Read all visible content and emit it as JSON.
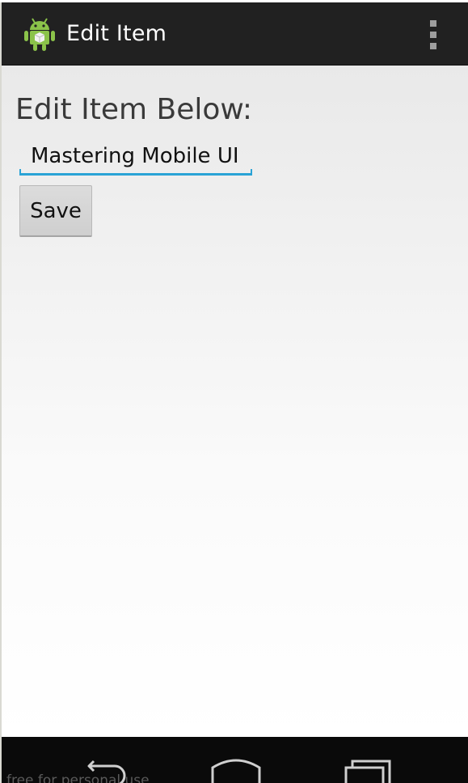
{
  "action_bar": {
    "title": "Edit Item",
    "app_icon": "android-robot-icon",
    "overflow_icon": "overflow-menu-icon",
    "background": "#212121"
  },
  "content": {
    "heading": "Edit Item Below:",
    "edit_field": {
      "value": "Mastering Mobile UI",
      "accent_color": "#2aa3d6"
    },
    "save_button": {
      "label": "Save"
    }
  },
  "nav_bar": {
    "buttons": [
      {
        "icon": "back-icon"
      },
      {
        "icon": "home-icon"
      },
      {
        "icon": "recent-apps-icon"
      }
    ],
    "watermark": "free for personal use"
  }
}
